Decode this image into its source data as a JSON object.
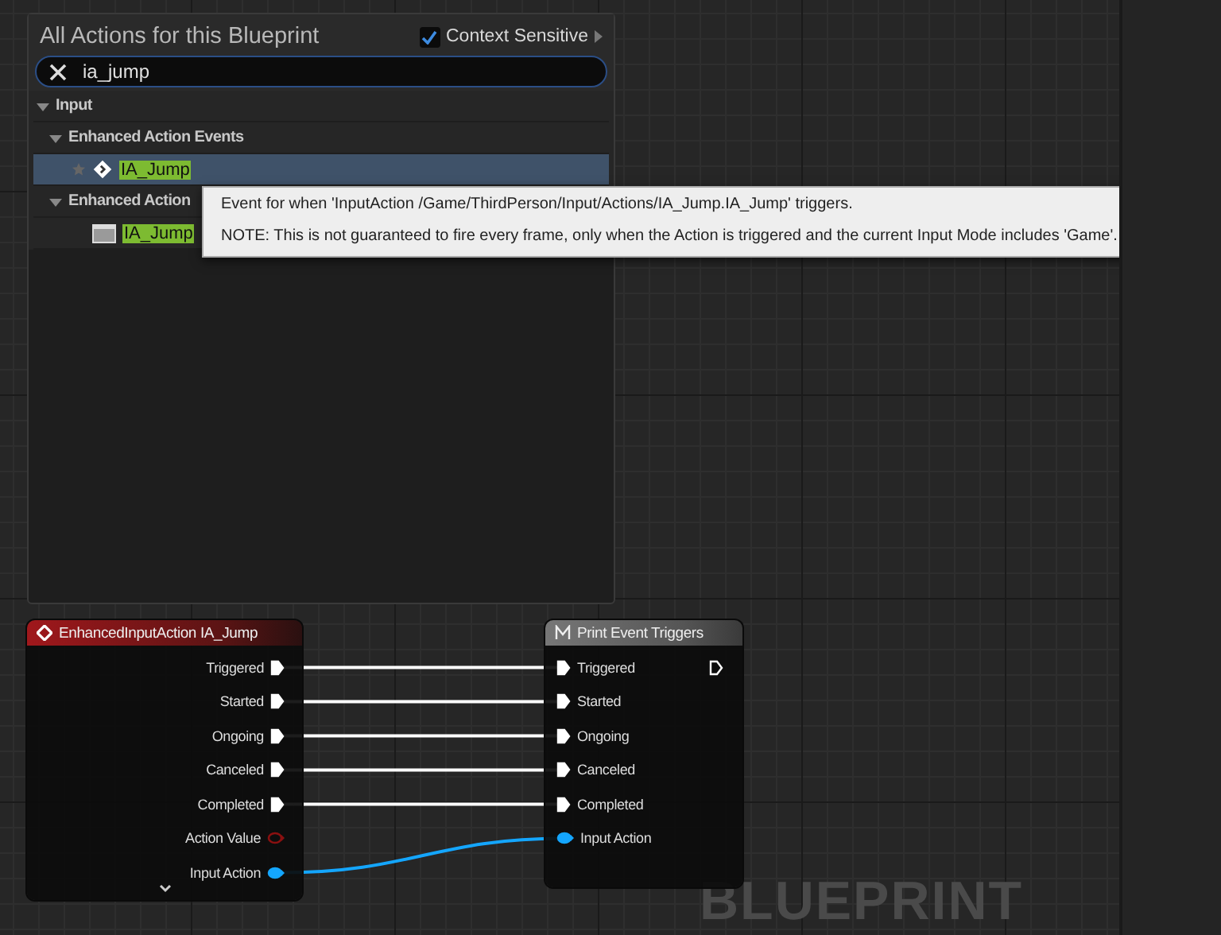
{
  "action_menu": {
    "title": "All Actions for this Blueprint",
    "context_sensitive": {
      "label": "Context Sensitive",
      "checked": true
    },
    "search": {
      "value": "ia_jump"
    },
    "tree": [
      {
        "label": "Input",
        "expanded": true,
        "children": [
          {
            "label": "Enhanced Action Events",
            "expanded": true,
            "children": [
              {
                "label": "IA_Jump",
                "kind": "event",
                "selected": true
              }
            ]
          },
          {
            "label": "Enhanced Action",
            "expanded": true,
            "children": [
              {
                "label": "IA_Jump",
                "kind": "asset",
                "selected": false
              }
            ]
          }
        ]
      }
    ]
  },
  "tooltip": {
    "lines": [
      "Event for when 'InputAction /Game/ThirdPerson/Input/Actions/IA_Jump.IA_Jump' triggers.",
      "NOTE: This is not guaranteed to fire every frame, only when the Action is triggered and the current Input Mode includes 'Game'."
    ]
  },
  "nodes": [
    {
      "title": "EnhancedInputAction IA_Jump",
      "kind": "event",
      "pins": [
        {
          "label": "Triggered",
          "kind": "exec",
          "connected": true,
          "color": "#ffffff"
        },
        {
          "label": "Started",
          "kind": "exec",
          "connected": true,
          "color": "#ffffff"
        },
        {
          "label": "Ongoing",
          "kind": "exec",
          "connected": true,
          "color": "#ffffff"
        },
        {
          "label": "Canceled",
          "kind": "exec",
          "connected": true,
          "color": "#ffffff"
        },
        {
          "label": "Completed",
          "kind": "exec",
          "connected": true,
          "color": "#ffffff"
        },
        {
          "label": "Action Value",
          "kind": "value",
          "connected": false,
          "color": "#8a1010"
        },
        {
          "label": "Input Action",
          "kind": "value",
          "connected": true,
          "color": "#14a6ff"
        }
      ]
    },
    {
      "title": "Print Event Triggers",
      "kind": "macro",
      "pins": [
        {
          "label": "Triggered",
          "kind": "exec",
          "connected": true,
          "color": "#ffffff"
        },
        {
          "label": "Started",
          "kind": "exec",
          "connected": true,
          "color": "#ffffff"
        },
        {
          "label": "Ongoing",
          "kind": "exec",
          "connected": true,
          "color": "#ffffff"
        },
        {
          "label": "Canceled",
          "kind": "exec",
          "connected": true,
          "color": "#ffffff"
        },
        {
          "label": "Completed",
          "kind": "exec",
          "connected": true,
          "color": "#ffffff"
        },
        {
          "label": "Input Action",
          "kind": "value",
          "connected": true,
          "color": "#14a6ff"
        }
      ],
      "outputs": [
        {
          "kind": "exec",
          "connected": false,
          "color": "#ffffff"
        }
      ]
    }
  ],
  "watermark": "BLUEPRINT"
}
